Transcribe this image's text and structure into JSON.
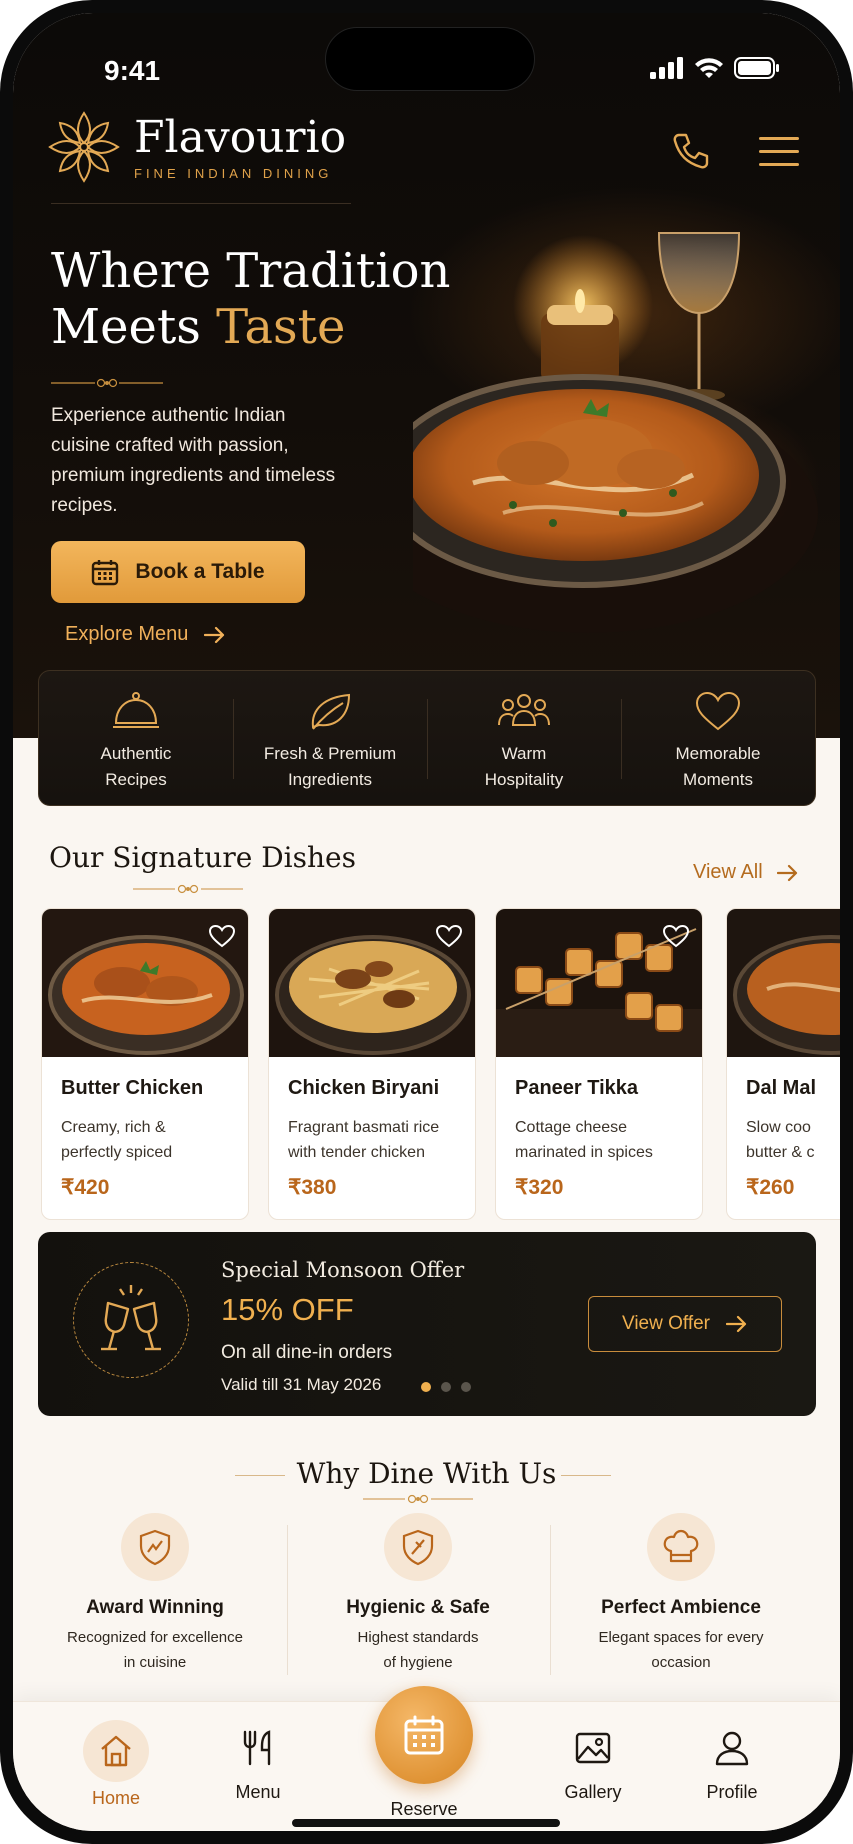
{
  "status_bar": {
    "time": "9:41"
  },
  "brand": {
    "name": "Flavourio",
    "tagline": "FINE INDIAN DINING"
  },
  "hero": {
    "headline_line1": "Where Tradition",
    "headline_line2_prefix": "Meets ",
    "headline_line2_accent": "Taste",
    "description": "Experience authentic Indian cuisine crafted with passion, premium ingredients and timeless recipes.",
    "book_button": "Book a Table",
    "explore_link": "Explore Menu"
  },
  "features": [
    {
      "icon": "cloche-icon",
      "label": "Authentic\nRecipes"
    },
    {
      "icon": "leaf-icon",
      "label": "Fresh & Premium\nIngredients"
    },
    {
      "icon": "people-icon",
      "label": "Warm\nHospitality"
    },
    {
      "icon": "heart-icon",
      "label": "Memorable\nMoments"
    }
  ],
  "signature": {
    "title": "Our Signature Dishes",
    "view_all": "View All",
    "dishes": [
      {
        "name": "Butter Chicken",
        "desc": "Creamy, rich &\nperfectly spiced",
        "price": "₹420"
      },
      {
        "name": "Chicken Biryani",
        "desc": "Fragrant basmati rice\nwith tender chicken",
        "price": "₹380"
      },
      {
        "name": "Paneer Tikka",
        "desc": "Cottage cheese\nmarinated in spices",
        "price": "₹320"
      },
      {
        "name": "Dal Mal",
        "desc": "Slow coo\nbutter & c",
        "price": "₹260"
      }
    ]
  },
  "offer": {
    "title": "Special Monsoon Offer",
    "discount": "15% OFF",
    "subtitle": "On all dine-in orders",
    "validity": "Valid till 31 May 2026",
    "button": "View Offer",
    "active_slide": 1,
    "slide_count": 3
  },
  "why": {
    "title": "Why Dine With Us",
    "items": [
      {
        "icon": "award-shield-icon",
        "name": "Award Winning",
        "desc": "Recognized for excellence\nin cuisine"
      },
      {
        "icon": "hygiene-shield-icon",
        "name": "Hygienic & Safe",
        "desc": "Highest standards\nof hygiene"
      },
      {
        "icon": "chef-hat-icon",
        "name": "Perfect Ambience",
        "desc": "Elegant spaces for every\noccasion"
      }
    ]
  },
  "nav": {
    "home": "Home",
    "menu": "Menu",
    "reserve": "Reserve",
    "gallery": "Gallery",
    "profile": "Profile",
    "active": "home"
  },
  "colors": {
    "accent_gold": "#e3a955",
    "button_gold": "#f3b65c",
    "price_brown": "#b9661b",
    "dark_bg": "#120d09",
    "cream_bg": "#faf6f1"
  }
}
